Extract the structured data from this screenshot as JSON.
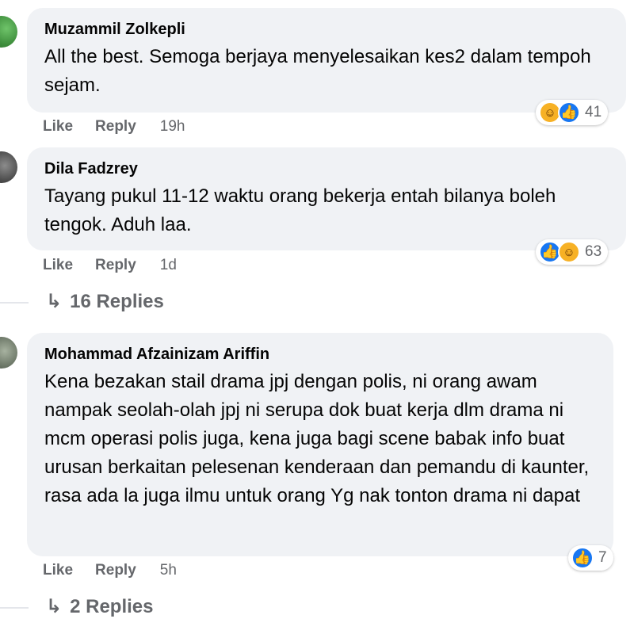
{
  "comments": [
    {
      "author": "Muzammil Zolkepli",
      "text": "All the best. Semoga berjaya menyelesaikan kes2 dalam tempoh sejam.",
      "like_label": "Like",
      "reply_label": "Reply",
      "time": "19h",
      "reactions": [
        "haha",
        "like"
      ],
      "reaction_count": "41"
    },
    {
      "author": "Dila Fadzrey",
      "text": "Tayang pukul 11-12 waktu orang bekerja entah bilanya boleh tengok. Aduh laa.",
      "like_label": "Like",
      "reply_label": "Reply",
      "time": "1d",
      "reactions": [
        "like",
        "haha"
      ],
      "reaction_count": "63",
      "replies_label": "16 Replies"
    },
    {
      "author": "Mohammad Afzainizam Ariffin",
      "text": "Kena bezakan stail drama jpj dengan polis, ni orang awam nampak seolah-olah jpj ni serupa dok buat kerja dlm drama ni mcm operasi polis juga, kena juga bagi scene babak info buat urusan berkaitan pelesenan kenderaan dan pemandu di kaunter, rasa ada la juga ilmu untuk orang Yg nak tonton drama ni dapat",
      "like_label": "Like",
      "reply_label": "Reply",
      "time": "5h",
      "reactions": [
        "like"
      ],
      "reaction_count": "7",
      "replies_label": "2 Replies"
    }
  ],
  "colors": {
    "bubble": "#f0f2f5",
    "like_blue": "#1877f2",
    "haha_yellow": "#f7b125",
    "meta_gray": "#65676b"
  }
}
